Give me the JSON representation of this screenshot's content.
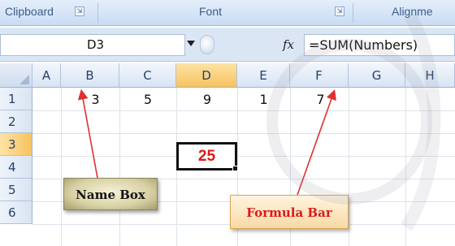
{
  "ribbon": {
    "groups": [
      {
        "label": "Clipboard",
        "launcher": "⇲"
      },
      {
        "label": "Font",
        "launcher": "⇲"
      },
      {
        "label": "Alignme",
        "launcher": ""
      }
    ]
  },
  "formula_bar": {
    "name_box_value": "D3",
    "fx_label": "fx",
    "formula_value": "=SUM(Numbers)"
  },
  "grid": {
    "columns": [
      "A",
      "B",
      "C",
      "D",
      "E",
      "F",
      "G",
      "H"
    ],
    "active_column": "D",
    "rows": [
      "1",
      "2",
      "3",
      "4",
      "5",
      "6"
    ],
    "active_row": "3",
    "row1_values": {
      "B": "3",
      "C": "5",
      "D": "9",
      "E": "1",
      "F": "7"
    },
    "active_cell_value": "25"
  },
  "callouts": {
    "name_box": "Name Box",
    "formula_bar": "Formula Bar"
  },
  "colors": {
    "active_cell_text": "#e01818",
    "formula_callout_text": "#d91b1b",
    "arrow": "#e03030",
    "header_active": "#f6c35f"
  }
}
